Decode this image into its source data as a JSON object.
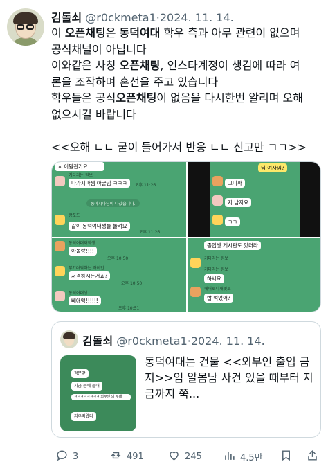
{
  "author": {
    "name": "김돌쇠",
    "handle": "@r0ckmeta1",
    "separator": "·",
    "date": "2024. 11. 14."
  },
  "tweet": {
    "l1_a": "이 ",
    "l1_b": "오픈채팅",
    "l1_c": "은 ",
    "l1_d": "동덕여대",
    "l1_e": " 학우 측과 아무 관련이 없으며",
    "l2": "공식채널이 아닙니다",
    "l3_a": "이와같은 사칭 ",
    "l3_b": "오픈채팅",
    "l3_c": ", 인스타계정이 생김에 따라 여",
    "l4": "론을 조작하며 혼선을 주고 있습니다",
    "l5_a": "학우들은 공식",
    "l5_b": "오픈채팅",
    "l5_c": "이 없음을 다시한번 알리며 오해",
    "l6": "없으시길 바랍니다",
    "l7": "<<오해 ㄴㄴ 굳이 들어가서 반응 ㄴㄴ 신고만 ㄱㄱ>>"
  },
  "media": {
    "tile1": {
      "msgs": [
        "ㅎ 이뭔관가요",
        "나가지마셈 아굴임 ㅋㅋㅋ",
        "같이 동덕여대생들 놀려요"
      ],
      "nicks": [
        "기다리는 원보",
        "왕포도"
      ],
      "times": [
        "오후 11:26",
        "오후 11:26"
      ],
      "system": "동아시아님이 나갔습니다."
    },
    "tile2": {
      "msgs": [
        "님 여자임?",
        "그니까",
        "저 남자요",
        "ㅋㅋ"
      ]
    },
    "tile3": {
      "msgs": [
        "아몰랑!!!!",
        "저격하시는거죠?",
        "빼애액!!!!!!"
      ],
      "nicks": [
        "동덕여대재학생",
        "부끄러워하는 라이언",
        "동덕여대생"
      ],
      "times": [
        "오후 10:50",
        "오후 10:50",
        "오후 10:51"
      ]
    },
    "tile4": {
      "msgs": [
        "졸업생 게시판도 있더라",
        "하세요",
        "밥 먹었어?"
      ],
      "nicks": [
        "기다리는 원보",
        "기다리는 원보",
        "페퍼로니재빗보"
      ]
    }
  },
  "quote": {
    "name": "김돌쇠",
    "handle": "@r0ckmeta1",
    "separator": "·",
    "date": "2024. 11. 14.",
    "text": "동덕여대는 건물 <<외부인 출입 금지>>임 알몸남 사건 있을 때부터 지금까지 쭉...",
    "thumb_msgs": [
      "정문앞",
      "지금 문에 들어",
      "ㅋㅋㅋㅋㅋㅋㅋㅋ 외부인 의 무대",
      "지우러왔다"
    ]
  },
  "actions": {
    "replies": "3",
    "retweets": "491",
    "likes": "245",
    "views": "4.5만"
  },
  "icons": [
    "reply-icon",
    "retweet-icon",
    "like-icon",
    "views-icon",
    "bookmark-icon",
    "share-icon"
  ],
  "colors": {
    "chat_green": "#4aa472",
    "text": "#0f1419",
    "muted": "#536471",
    "border": "#cfd9de"
  }
}
